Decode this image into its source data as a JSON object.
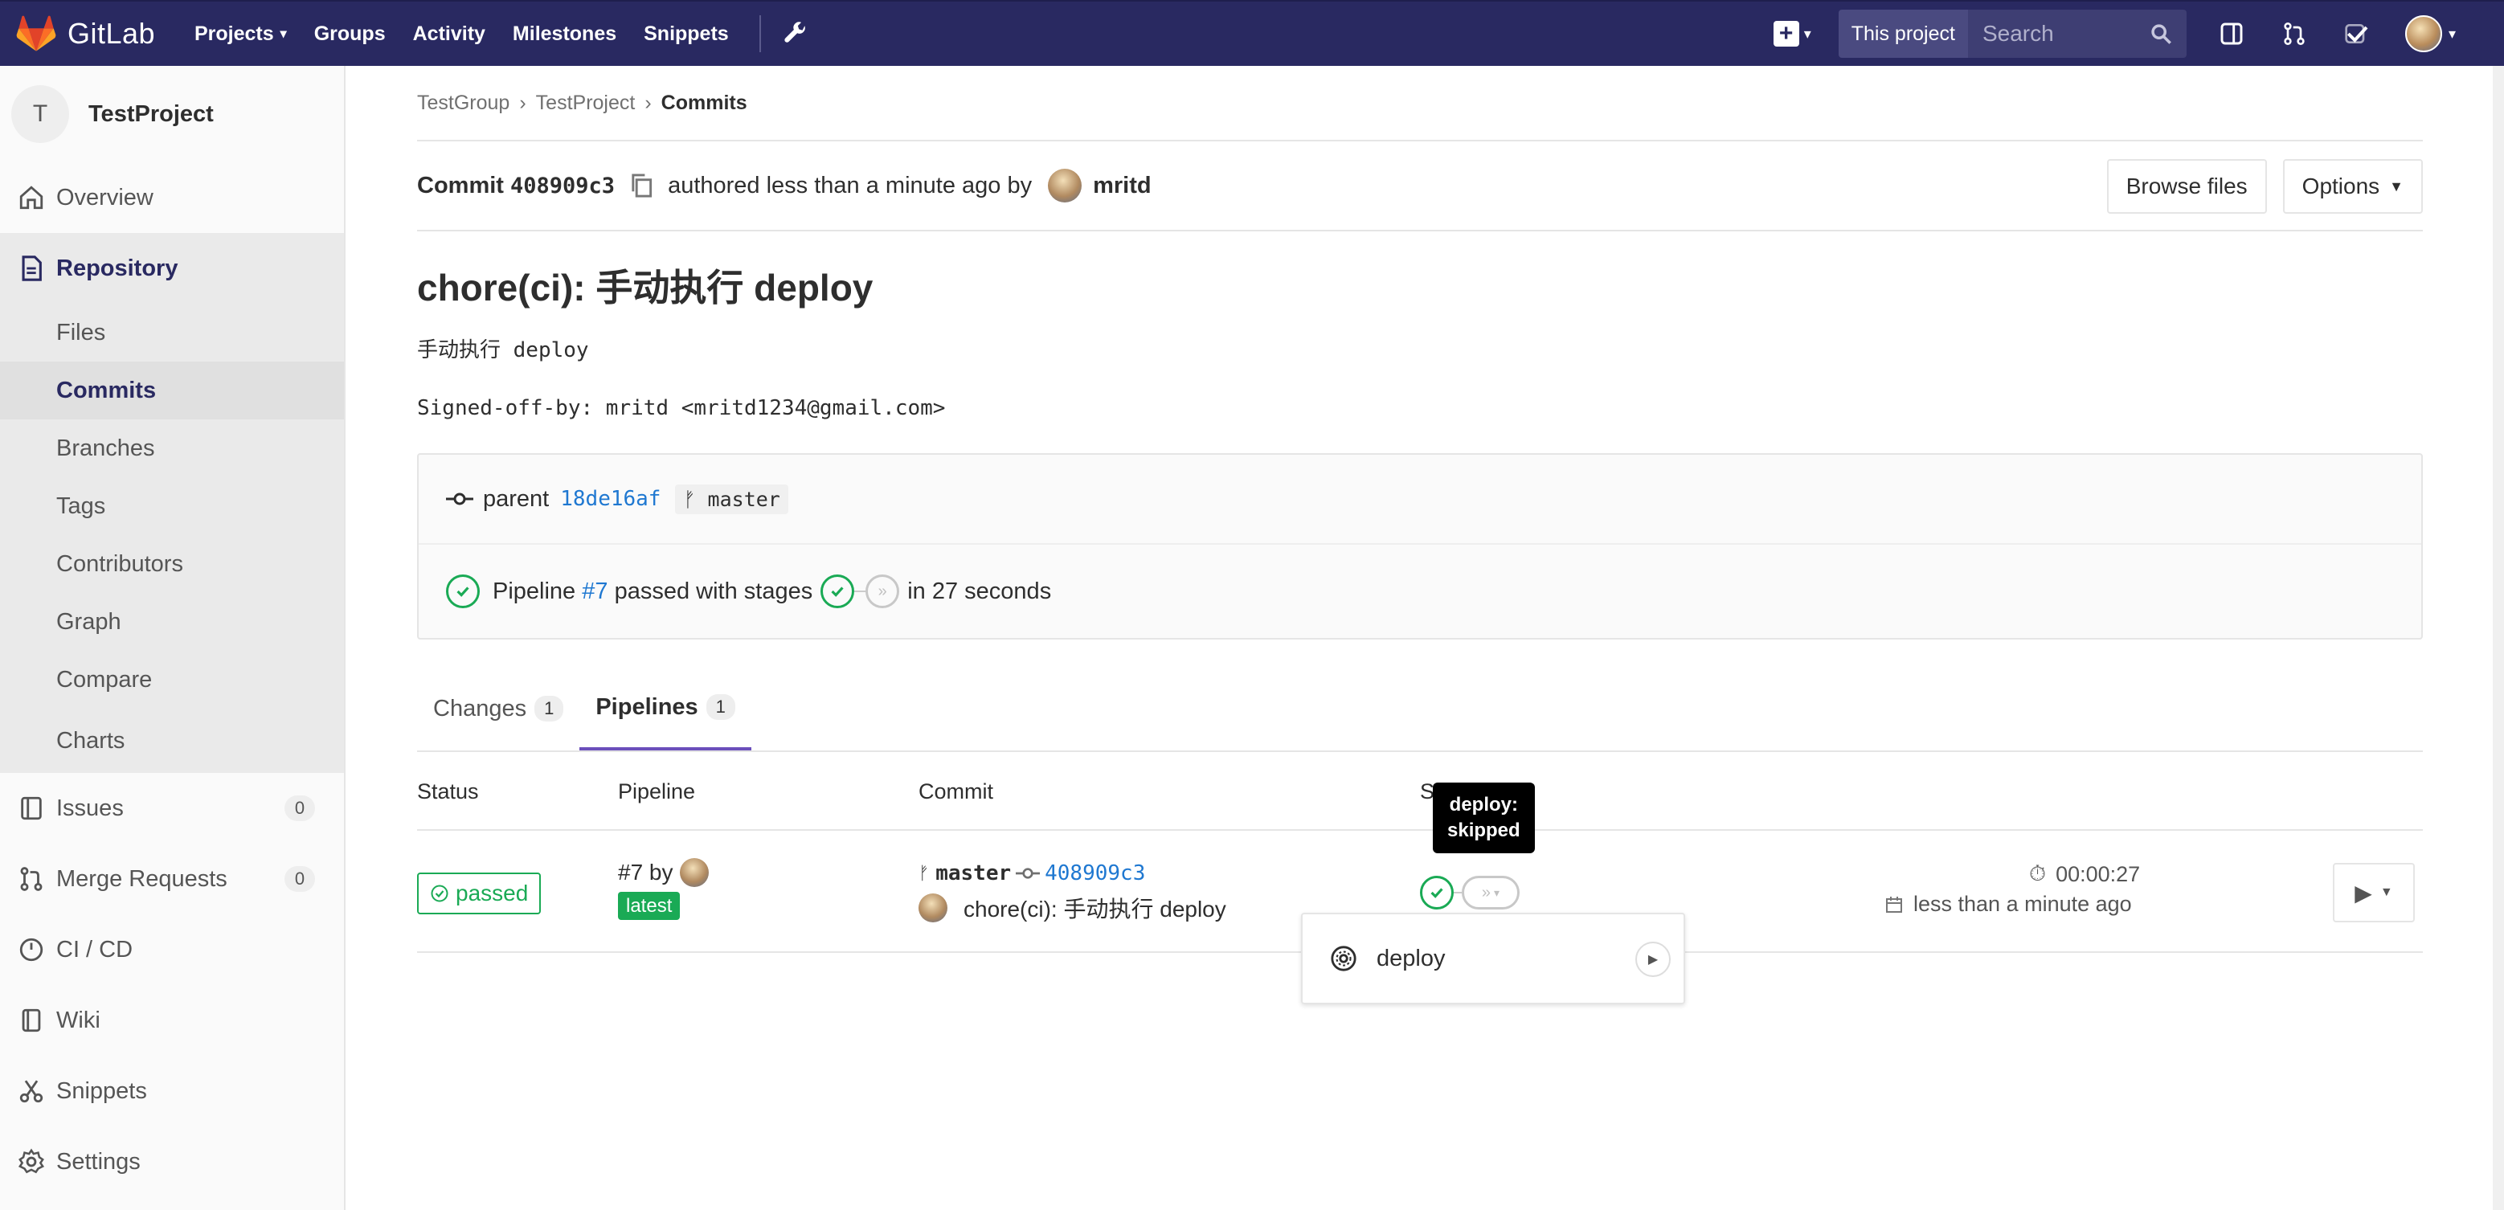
{
  "app": {
    "name": "GitLab"
  },
  "nav": {
    "projects": "Projects",
    "groups": "Groups",
    "activity": "Activity",
    "milestones": "Milestones",
    "snippets": "Snippets",
    "search_scope": "This project",
    "search_placeholder": "Search"
  },
  "sidebar": {
    "project_initial": "T",
    "project_name": "TestProject",
    "items": [
      {
        "label": "Overview"
      },
      {
        "label": "Repository"
      },
      {
        "label": "Issues",
        "count": "0"
      },
      {
        "label": "Merge Requests",
        "count": "0"
      },
      {
        "label": "CI / CD"
      },
      {
        "label": "Wiki"
      },
      {
        "label": "Snippets"
      },
      {
        "label": "Settings"
      }
    ],
    "repo_sub": [
      "Files",
      "Commits",
      "Branches",
      "Tags",
      "Contributors",
      "Graph",
      "Compare",
      "Charts"
    ]
  },
  "breadcrumb": {
    "group": "TestGroup",
    "project": "TestProject",
    "current": "Commits"
  },
  "commit": {
    "label": "Commit",
    "sha": "408909c3",
    "authored": "authored less than a minute ago by",
    "author": "mritd",
    "browse_files": "Browse files",
    "options": "Options",
    "title": "chore(ci): 手动执行 deploy",
    "body_line1": "手动执行 deploy",
    "body_line2": "Signed-off-by: mritd <mritd1234@gmail.com>",
    "parent_label": "parent",
    "parent_sha": "18de16af",
    "parent_branch": "master",
    "pipeline_prefix": "Pipeline",
    "pipeline_id": "#7",
    "pipeline_mid": "passed with stages",
    "pipeline_suffix": "in 27 seconds"
  },
  "tabs": [
    {
      "label": "Changes",
      "count": "1"
    },
    {
      "label": "Pipelines",
      "count": "1"
    }
  ],
  "table": {
    "headers": [
      "Status",
      "Pipeline",
      "Commit",
      "Stages"
    ],
    "row": {
      "status": "passed",
      "pipeline": "#7 by",
      "latest": "latest",
      "branch": "master",
      "sha": "408909c3",
      "message": "chore(ci): 手动执行 deploy",
      "duration": "00:00:27",
      "finished": "less than a minute ago"
    }
  },
  "tooltip": {
    "line1": "deploy:",
    "line2": "skipped"
  },
  "dropdown": {
    "job": "deploy"
  },
  "colors": {
    "nav": "#292961",
    "success": "#1aaa55",
    "link": "#1f78d1",
    "tab_active": "#6b4fbb"
  }
}
